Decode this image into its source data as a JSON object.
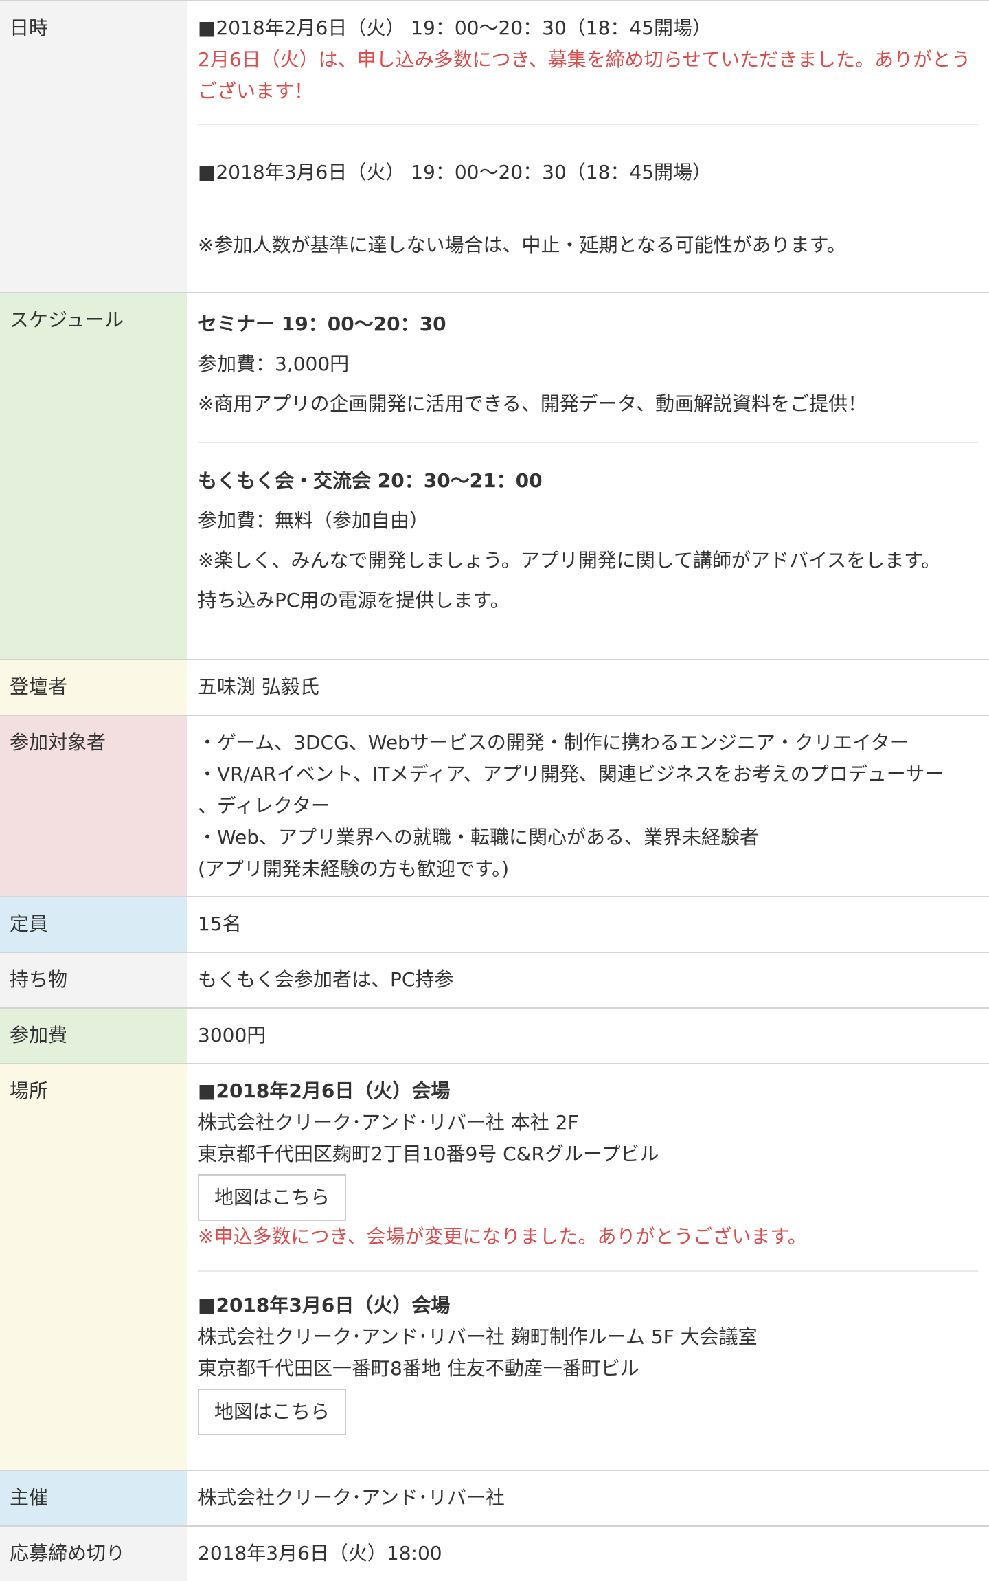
{
  "datetime": {
    "label": "日時",
    "line1": "■2018年2月6日（火） 19：00〜20：30（18：45開場）",
    "closed_notice": "2月6日（火）は、申し込み多数につき、募集を締め切らせていただきました。ありがとうございます！",
    "line2": "■2018年3月6日（火） 19：00〜20：30（18：45開場）",
    "note": "※参加人数が基準に達しない場合は、中止・延期となる可能性があります。"
  },
  "schedule": {
    "label": "スケジュール",
    "seminar_title": "セミナー 19：00〜20：30",
    "seminar_fee": "参加費：3,000円",
    "seminar_note": "※商用アプリの企画開発に活用できる、開発データ、動画解説資料をご提供！",
    "mokumoku_title": "もくもく会・交流会 20：30〜21：00",
    "mokumoku_fee": "参加費：無料（参加自由）",
    "mokumoku_note1": "※楽しく、みんなで開発しましょう。アプリ開発に関して講師がアドバイスをします。",
    "mokumoku_note2": "持ち込みPC用の電源を提供します。"
  },
  "speaker": {
    "label": "登壇者",
    "value": "五味渕 弘毅氏"
  },
  "audience": {
    "label": "参加対象者",
    "line1": "・ゲーム、3DCG、Webサービスの開発・制作に携わるエンジニア・クリエイター",
    "line2": "・VR/ARイベント、ITメディア、アプリ開発、関連ビジネスをお考えのプロデューサー",
    "line3": "、ディレクター",
    "line4": "・Web、アプリ業界への就職・転職に関心がある、業界未経験者",
    "line5": "(アプリ開発未経験の方も歓迎です。)"
  },
  "capacity": {
    "label": "定員",
    "value": "15名"
  },
  "belongings": {
    "label": "持ち物",
    "value": "もくもく会参加者は、PC持参"
  },
  "fee": {
    "label": "参加費",
    "value": "3000円"
  },
  "venue": {
    "label": "場所",
    "v1_title": "■2018年2月6日（火）会場",
    "v1_name": "株式会社クリーク･アンド･リバー社 本社 2F",
    "v1_address": "東京都千代田区麹町2丁目10番9号 C&Rグループビル",
    "map_button": "地図はこちら",
    "v1_notice": "※申込多数につき、会場が変更になりました。ありがとうございます。",
    "v2_title": "■2018年3月6日（火）会場",
    "v2_name": "株式会社クリーク･アンド･リバー社 麹町制作ルーム 5F 大会議室",
    "v2_address": "東京都千代田区一番町8番地 住友不動産一番町ビル"
  },
  "organizer": {
    "label": "主催",
    "value": "株式会社クリーク･アンド･リバー社"
  },
  "deadline": {
    "label": "応募締め切り",
    "value": "2018年3月6日（火）18:00"
  }
}
